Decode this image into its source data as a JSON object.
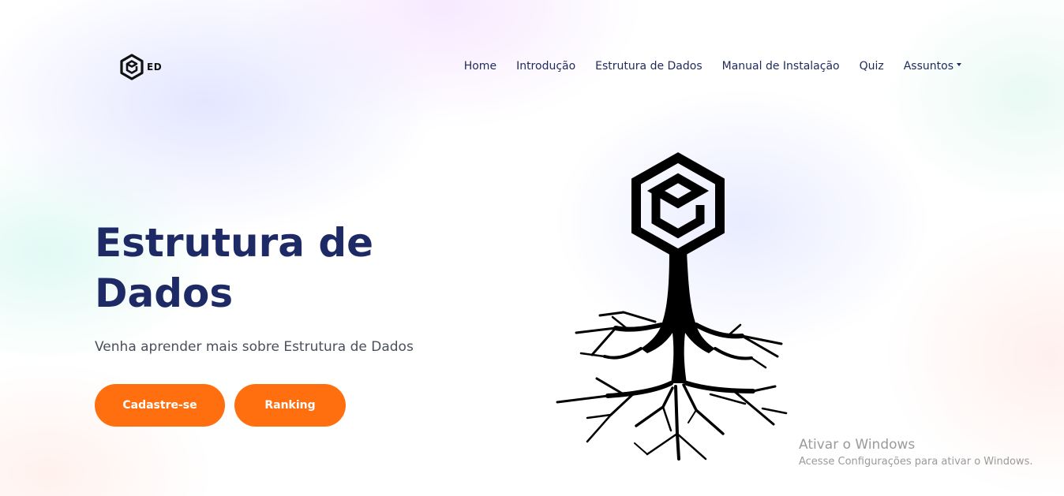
{
  "header": {
    "logo_text": "ED",
    "nav": [
      {
        "label": "Home"
      },
      {
        "label": "Introdução"
      },
      {
        "label": "Estrutura de Dados"
      },
      {
        "label": "Manual de Instalação"
      },
      {
        "label": "Quiz"
      },
      {
        "label": "Assuntos"
      }
    ]
  },
  "hero": {
    "title": "Estrutura de Dados",
    "subtitle": "Venha aprender mais sobre Estrutura de Dados",
    "signup_label": "Cadastre-se",
    "ranking_label": "Ranking",
    "illustration_icon": "hexagon-tree-roots-illustration"
  },
  "watermark": {
    "title": "Ativar o Windows",
    "subtitle": "Acesse Configurações para ativar o Windows."
  },
  "colors": {
    "accent": "#ff6f0f",
    "title": "#1e2a66",
    "nav": "#1f2a5a"
  }
}
